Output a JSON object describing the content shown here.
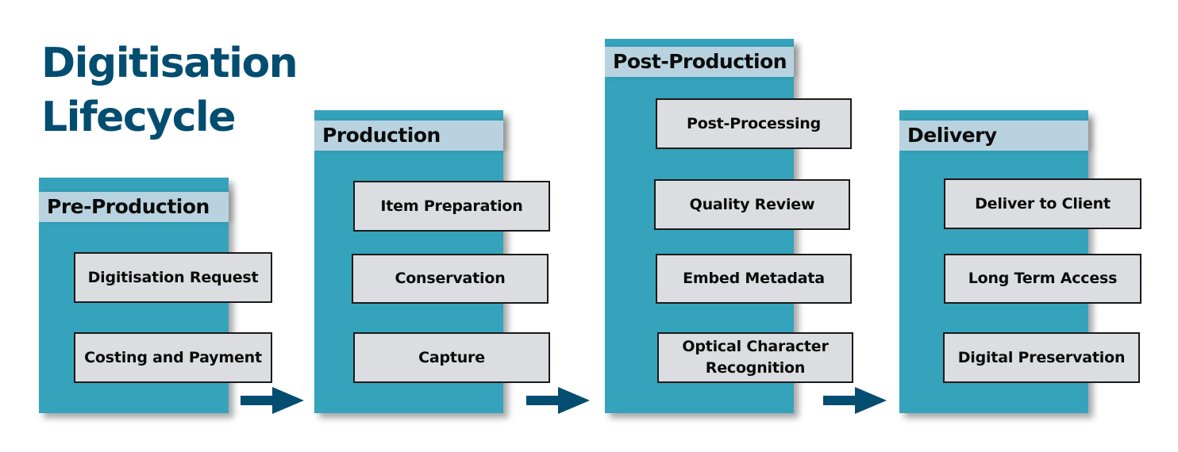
{
  "title": {
    "line1": "Digitisation",
    "line2": "Lifecycle"
  },
  "colors": {
    "title": "#024d70",
    "panel": "#34a3bb",
    "panel_header": "#b8d3df",
    "step_box": "#dcdde0",
    "arrow": "#024d70"
  },
  "stages": [
    {
      "name": "Pre-Production",
      "steps": [
        "Digitisation Request",
        "Costing and Payment"
      ]
    },
    {
      "name": "Production",
      "steps": [
        "Item Preparation",
        "Conservation",
        "Capture"
      ]
    },
    {
      "name": "Post-Production",
      "steps": [
        "Post-Processing",
        "Quality Review",
        "Embed Metadata",
        "Optical Character Recognition"
      ]
    },
    {
      "name": "Delivery",
      "steps": [
        "Deliver to Client",
        "Long Term Access",
        "Digital Preservation"
      ]
    }
  ],
  "arrows": [
    {
      "from": "Pre-Production",
      "to": "Production",
      "icon": "right-arrow-icon"
    },
    {
      "from": "Production",
      "to": "Post-Production",
      "icon": "right-arrow-icon"
    },
    {
      "from": "Post-Production",
      "to": "Delivery",
      "icon": "right-arrow-icon"
    }
  ]
}
